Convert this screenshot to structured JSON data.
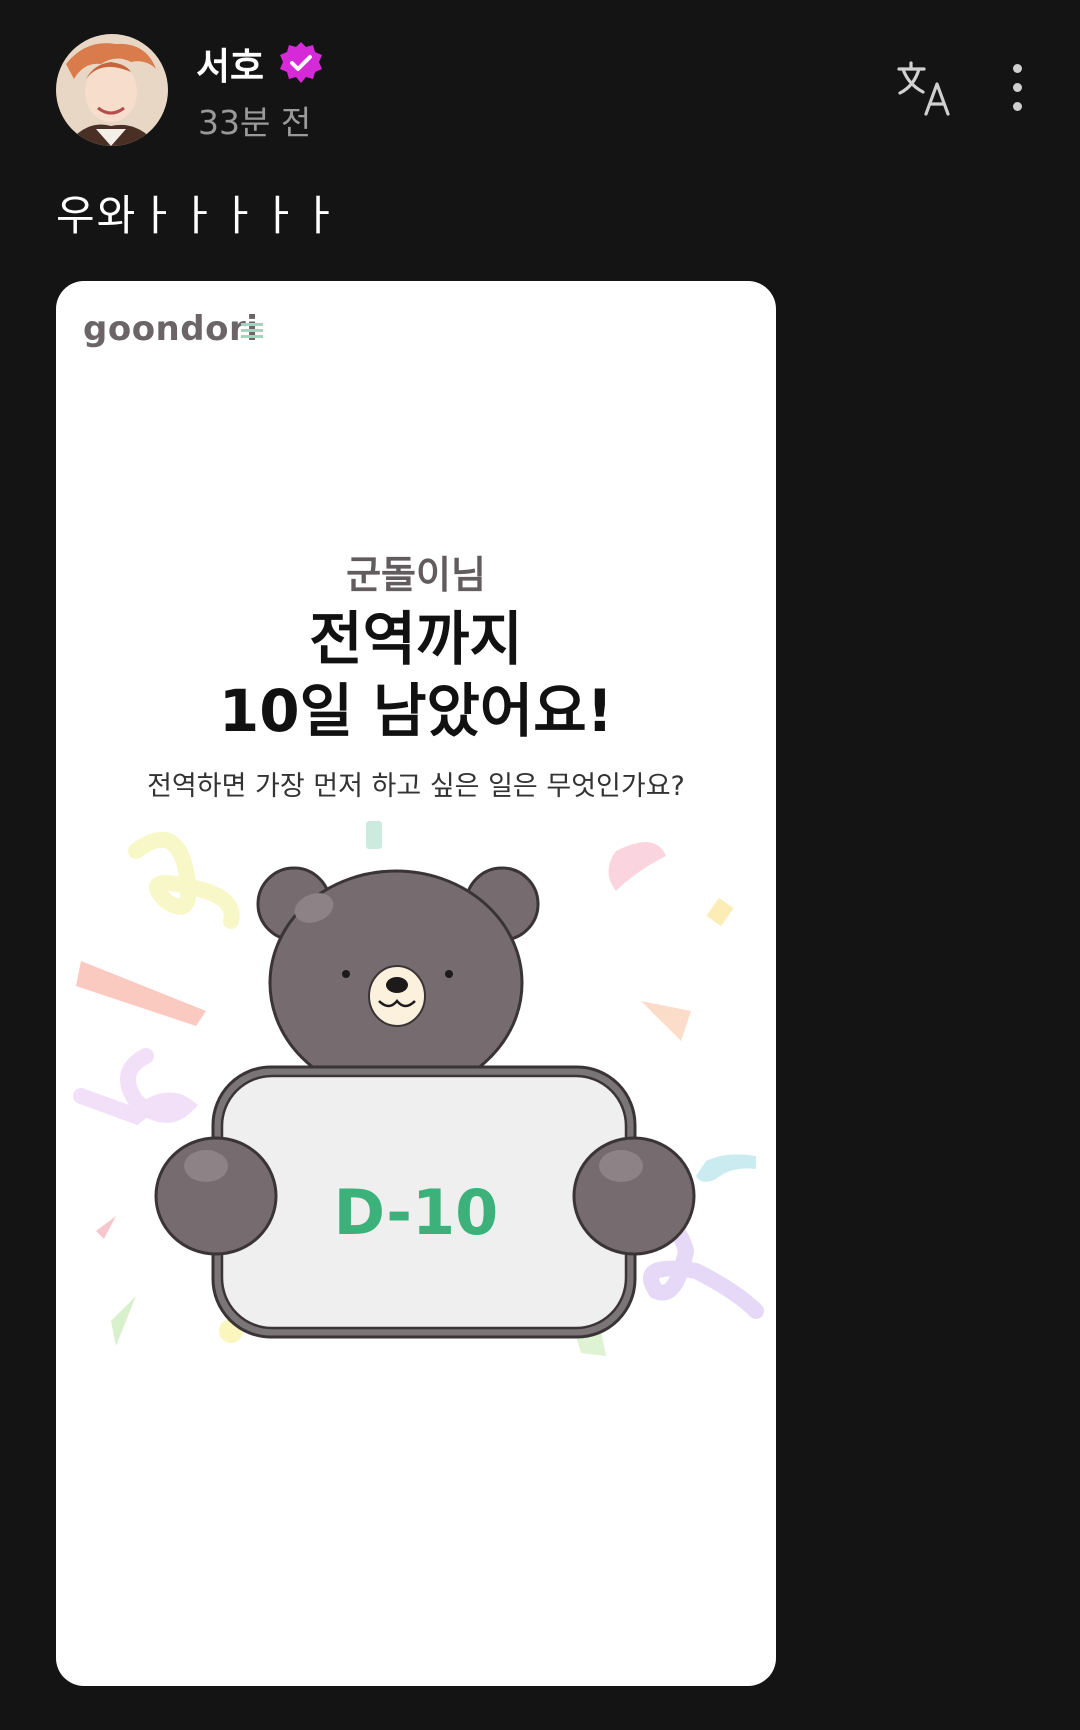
{
  "post": {
    "author": "서호",
    "time_ago": "33분 전",
    "text": "우와ㅏㅏㅏㅏㅏ"
  },
  "icons": {
    "avatar": "profile-photo",
    "verified": "verified-badge-icon",
    "translate": "translate-icon",
    "more": "more-vertical-icon"
  },
  "card": {
    "logo": "goondori",
    "greeting": "군돌이님",
    "headline_line1": "전역까지",
    "headline_line2": "10일 남았어요!",
    "question": "전역하면 가장 먼저 하고 싶은 일은 무엇인가요?",
    "sign_text": "D-10"
  },
  "colors": {
    "background": "#141414",
    "verified": "#d62ad8",
    "accent_green": "#3cb27a",
    "bear": "#766b6e"
  }
}
